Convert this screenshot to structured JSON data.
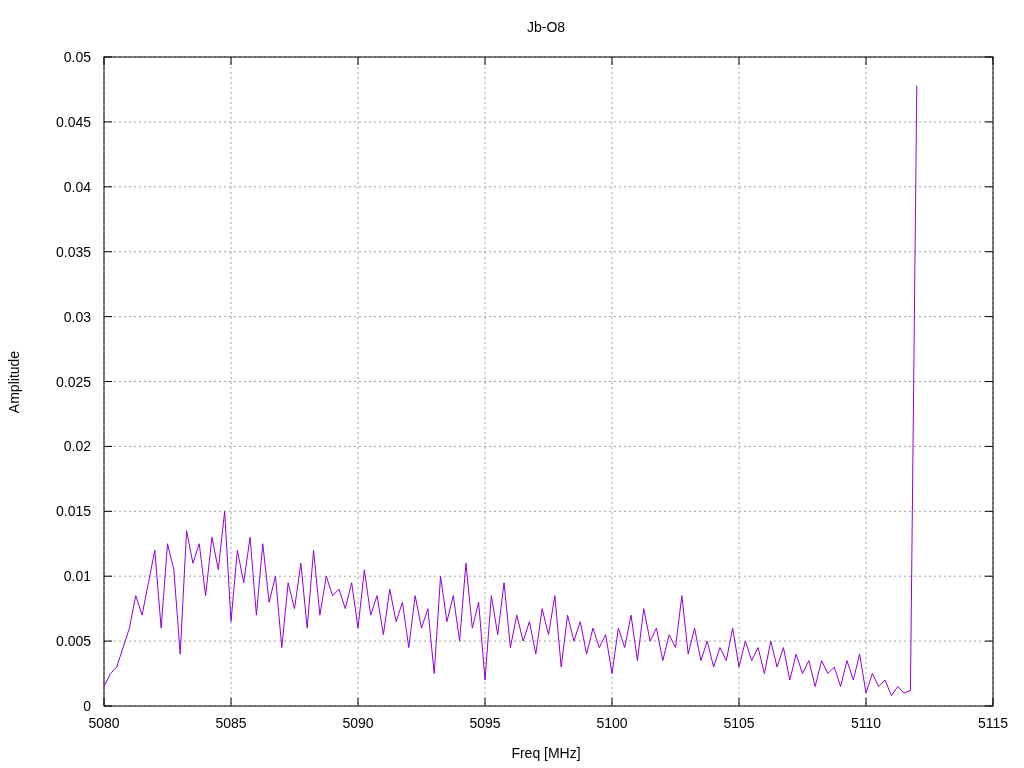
{
  "chart_data": {
    "type": "line",
    "title": "Jb-O8",
    "xlabel": "Freq [MHz]",
    "ylabel": "Amplitude",
    "xlim": [
      5080,
      5115
    ],
    "ylim": [
      0,
      0.05
    ],
    "xticks": [
      5080,
      5085,
      5090,
      5095,
      5100,
      5105,
      5110,
      5115
    ],
    "yticks": [
      {
        "value": 0,
        "label": "0"
      },
      {
        "value": 0.005,
        "label": "0.005"
      },
      {
        "value": 0.01,
        "label": "0.01"
      },
      {
        "value": 0.015,
        "label": "0.015"
      },
      {
        "value": 0.02,
        "label": "0.02"
      },
      {
        "value": 0.025,
        "label": "0.025"
      },
      {
        "value": 0.03,
        "label": "0.03"
      },
      {
        "value": 0.035,
        "label": "0.035"
      },
      {
        "value": 0.04,
        "label": "0.04"
      },
      {
        "value": 0.045,
        "label": "0.045"
      },
      {
        "value": 0.05,
        "label": "0.05"
      }
    ],
    "x": [
      5080,
      5080.25,
      5080.5,
      5080.75,
      5081,
      5081.25,
      5081.5,
      5081.75,
      5082,
      5082.25,
      5082.5,
      5082.75,
      5083,
      5083.25,
      5083.5,
      5083.75,
      5084,
      5084.25,
      5084.5,
      5084.75,
      5085,
      5085.25,
      5085.5,
      5085.75,
      5086,
      5086.25,
      5086.5,
      5086.75,
      5087,
      5087.25,
      5087.5,
      5087.75,
      5088,
      5088.25,
      5088.5,
      5088.75,
      5089,
      5089.25,
      5089.5,
      5089.75,
      5090,
      5090.25,
      5090.5,
      5090.75,
      5091,
      5091.25,
      5091.5,
      5091.75,
      5092,
      5092.25,
      5092.5,
      5092.75,
      5093,
      5093.25,
      5093.5,
      5093.75,
      5094,
      5094.25,
      5094.5,
      5094.75,
      5095,
      5095.25,
      5095.5,
      5095.75,
      5096,
      5096.25,
      5096.5,
      5096.75,
      5097,
      5097.25,
      5097.5,
      5097.75,
      5098,
      5098.25,
      5098.5,
      5098.75,
      5099,
      5099.25,
      5099.5,
      5099.75,
      5100,
      5100.25,
      5100.5,
      5100.75,
      5101,
      5101.25,
      5101.5,
      5101.75,
      5102,
      5102.25,
      5102.5,
      5102.75,
      5103,
      5103.25,
      5103.5,
      5103.75,
      5104,
      5104.25,
      5104.5,
      5104.75,
      5105,
      5105.25,
      5105.5,
      5105.75,
      5106,
      5106.25,
      5106.5,
      5106.75,
      5107,
      5107.25,
      5107.5,
      5107.75,
      5108,
      5108.25,
      5108.5,
      5108.75,
      5109,
      5109.25,
      5109.5,
      5109.75,
      5110,
      5110.25,
      5110.5,
      5110.75,
      5111,
      5111.25,
      5111.5,
      5111.75,
      5112
    ],
    "grid": true,
    "series": [
      {
        "color": "#9400d3",
        "values": [
          0.0015,
          0.0025,
          0.003,
          0.0045,
          0.006,
          0.0085,
          0.007,
          0.0095,
          0.012,
          0.006,
          0.0125,
          0.0105,
          0.004,
          0.0135,
          0.011,
          0.0125,
          0.0085,
          0.013,
          0.0105,
          0.015,
          0.0065,
          0.012,
          0.0095,
          0.013,
          0.007,
          0.0125,
          0.008,
          0.01,
          0.0045,
          0.0095,
          0.0075,
          0.011,
          0.006,
          0.012,
          0.007,
          0.01,
          0.0085,
          0.009,
          0.0075,
          0.0095,
          0.006,
          0.0105,
          0.007,
          0.0085,
          0.0055,
          0.009,
          0.0065,
          0.008,
          0.0045,
          0.0085,
          0.006,
          0.0075,
          0.0025,
          0.01,
          0.0065,
          0.0085,
          0.005,
          0.011,
          0.006,
          0.008,
          0.002,
          0.0085,
          0.0055,
          0.0095,
          0.0045,
          0.007,
          0.005,
          0.0065,
          0.004,
          0.0075,
          0.0055,
          0.0085,
          0.003,
          0.007,
          0.005,
          0.0065,
          0.004,
          0.006,
          0.0045,
          0.0055,
          0.0025,
          0.006,
          0.0045,
          0.007,
          0.0035,
          0.0075,
          0.005,
          0.006,
          0.0035,
          0.0055,
          0.0045,
          0.0085,
          0.004,
          0.006,
          0.0035,
          0.005,
          0.003,
          0.0045,
          0.0035,
          0.006,
          0.003,
          0.005,
          0.0035,
          0.0045,
          0.0025,
          0.005,
          0.003,
          0.0045,
          0.002,
          0.004,
          0.0025,
          0.0035,
          0.0015,
          0.0035,
          0.0025,
          0.003,
          0.0015,
          0.0035,
          0.002,
          0.004,
          0.001,
          0.0025,
          0.0015,
          0.002,
          0.0008,
          0.0015,
          0.001,
          0.0012,
          0.0478
        ]
      }
    ]
  }
}
